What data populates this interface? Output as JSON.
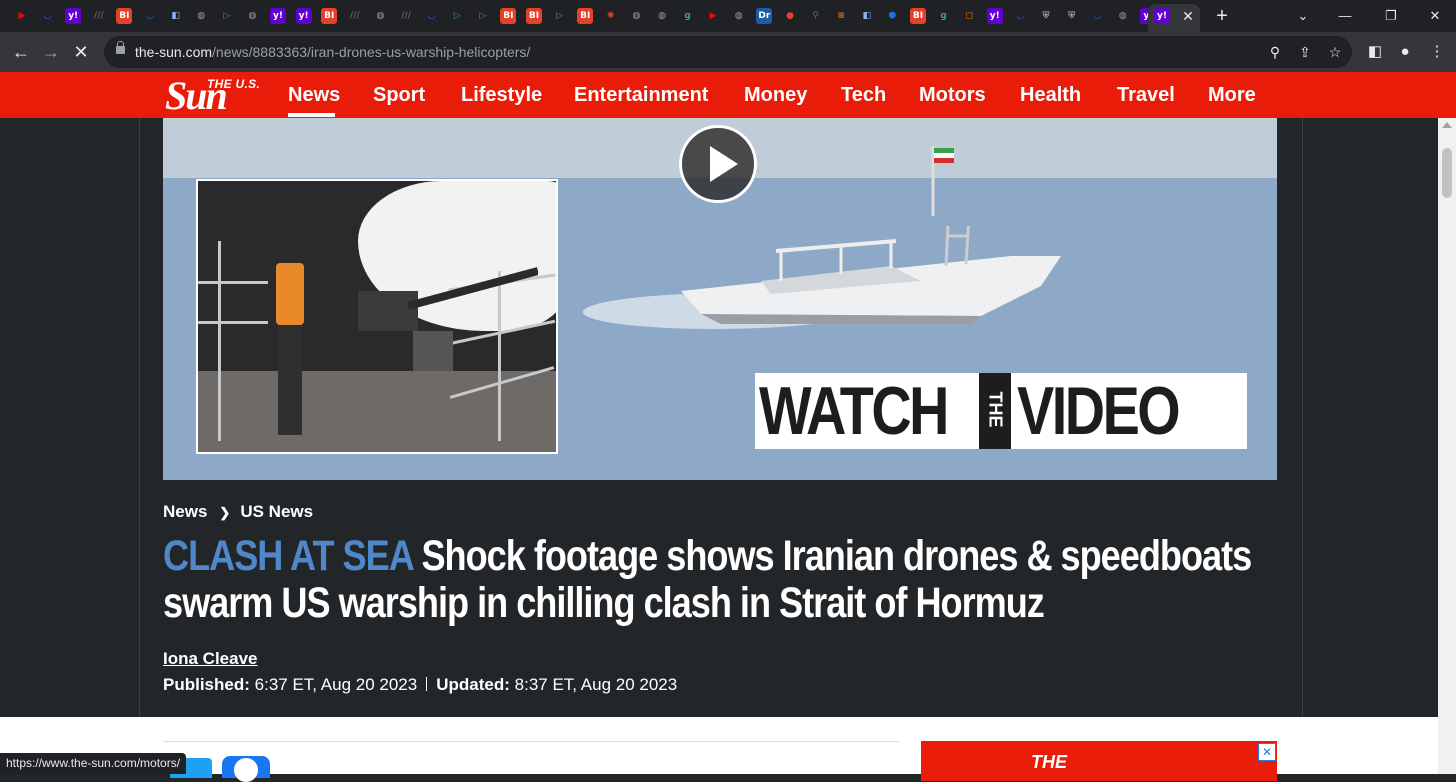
{
  "browser": {
    "tabs_favicons": [
      {
        "icon": "youtube-icon",
        "glyph": "▶",
        "color": "#ff0000"
      },
      {
        "icon": "shield-icon",
        "glyph": "◡",
        "color": "#1a73e8"
      },
      {
        "icon": "yahoo-icon",
        "glyph": "y!",
        "color": "#6001d2"
      },
      {
        "icon": "slash-icon",
        "glyph": "///",
        "color": "#5f6368"
      },
      {
        "icon": "bi-icon",
        "glyph": "BI",
        "color": "#e4412b"
      },
      {
        "icon": "shield-icon",
        "glyph": "◡",
        "color": "#1a73e8"
      },
      {
        "icon": "media-icon",
        "glyph": "◧",
        "color": "#8ab4f8"
      },
      {
        "icon": "globe-icon",
        "glyph": "◍",
        "color": "#9aa0a6"
      },
      {
        "icon": "play-icon",
        "glyph": "▷",
        "color": "#34a853"
      },
      {
        "icon": "globe-icon",
        "glyph": "◍",
        "color": "#9aa0a6"
      },
      {
        "icon": "yahoo-icon",
        "glyph": "y!",
        "color": "#6001d2"
      },
      {
        "icon": "yahoo-icon",
        "glyph": "y!",
        "color": "#6001d2"
      },
      {
        "icon": "bi-icon",
        "glyph": "BI",
        "color": "#e4412b"
      },
      {
        "icon": "slash-icon",
        "glyph": "///",
        "color": "#5f6368"
      },
      {
        "icon": "globe-icon",
        "glyph": "◍",
        "color": "#9aa0a6"
      },
      {
        "icon": "slash-icon",
        "glyph": "///",
        "color": "#5f6368"
      },
      {
        "icon": "shield-icon",
        "glyph": "◡",
        "color": "#1a73e8"
      },
      {
        "icon": "play-icon",
        "glyph": "▷",
        "color": "#34a853"
      },
      {
        "icon": "play-icon",
        "glyph": "▷",
        "color": "#34a853"
      },
      {
        "icon": "bi-icon",
        "glyph": "BI",
        "color": "#e4412b"
      },
      {
        "icon": "bi-icon",
        "glyph": "BI",
        "color": "#e4412b"
      },
      {
        "icon": "play-icon",
        "glyph": "▷",
        "color": "#34a853"
      },
      {
        "icon": "bi-icon",
        "glyph": "BI",
        "color": "#e4412b"
      },
      {
        "icon": "burst-icon",
        "glyph": "✺",
        "color": "#e4412b"
      },
      {
        "icon": "globe-icon",
        "glyph": "◍",
        "color": "#9aa0a6"
      },
      {
        "icon": "globe-icon",
        "glyph": "◍",
        "color": "#9aa0a6"
      },
      {
        "icon": "g-icon",
        "glyph": "g",
        "color": "#2fb35a"
      },
      {
        "icon": "youtube-icon",
        "glyph": "▶",
        "color": "#ff0000"
      },
      {
        "icon": "globe-icon",
        "glyph": "◍",
        "color": "#9aa0a6"
      },
      {
        "icon": "dr-icon",
        "glyph": "Dr",
        "color": "#1a5ca6"
      },
      {
        "icon": "mic-icon",
        "glyph": "●",
        "color": "#e4412b"
      },
      {
        "icon": "search-icon",
        "glyph": "⚲",
        "color": "#1a73e8"
      },
      {
        "icon": "bars-icon",
        "glyph": "≡",
        "color": "#f57c00"
      },
      {
        "icon": "media-icon",
        "glyph": "◧",
        "color": "#8ab4f8"
      },
      {
        "icon": "cube-icon",
        "glyph": "⬢",
        "color": "#1a73e8"
      },
      {
        "icon": "bi-icon",
        "glyph": "BI",
        "color": "#e4412b"
      },
      {
        "icon": "g-icon",
        "glyph": "g",
        "color": "#2fb35a"
      },
      {
        "icon": "badge-icon",
        "glyph": "◻",
        "color": "#f57c00"
      },
      {
        "icon": "yahoo-icon",
        "glyph": "y!",
        "color": "#6001d2"
      },
      {
        "icon": "shield-icon",
        "glyph": "◡",
        "color": "#1a73e8"
      },
      {
        "icon": "crest-icon",
        "glyph": "⛨",
        "color": "#9aa0a6"
      },
      {
        "icon": "crest-icon",
        "glyph": "⛨",
        "color": "#9aa0a6"
      },
      {
        "icon": "shield-icon",
        "glyph": "◡",
        "color": "#1a73e8"
      },
      {
        "icon": "globe-icon",
        "glyph": "◍",
        "color": "#9aa0a6"
      },
      {
        "icon": "yahoo-icon",
        "glyph": "y!",
        "color": "#6001d2"
      }
    ],
    "url_host": "the-sun.com",
    "url_path": "/news/8883363/iran-drones-us-warship-helicopters/",
    "status_url": "https://www.the-sun.com/motors/"
  },
  "site": {
    "logo_top": "THE U.S.",
    "logo_main": "Sun",
    "accent_color": "#e91c09",
    "nav": [
      "News",
      "Sport",
      "Lifestyle",
      "Entertainment",
      "Money",
      "Tech",
      "Motors",
      "Health",
      "Travel",
      "More"
    ],
    "active_nav": "News"
  },
  "video": {
    "overlay_word_1": "WATCH",
    "overlay_the": "THE",
    "overlay_word_2": "VIDEO"
  },
  "article": {
    "breadcrumb": [
      "News",
      "US News"
    ],
    "kicker": "CLASH AT SEA",
    "kicker_color": "#4f87c9",
    "headline": "Shock footage shows Iranian drones & speedboats swarm US warship in chilling clash in Strait of Hormuz",
    "author": "Iona Cleave",
    "published_label": "Published:",
    "published_value": "6:37 ET, Aug 20 2023",
    "updated_label": "Updated:",
    "updated_value": "8:37 ET, Aug 20 2023"
  },
  "ad": {
    "text": "THE"
  }
}
